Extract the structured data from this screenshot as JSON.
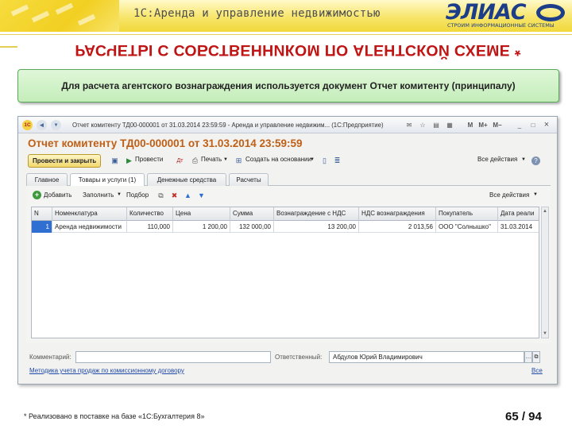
{
  "slide": {
    "app_heading": "1С:Аренда и управление недвижимостью",
    "logo_text": "ЭЛИАС",
    "logo_tagline": "СТРОИМ ИНФОРМАЦИОННЫЕ СИСТЕМЫ",
    "title": "РАСЧЕТЫ С СОБСТВЕННИКОМ ПО АГЕНТСКОЙ СХЕМЕ *",
    "info_text": "Для расчета агентского вознаграждения используется документ Отчет комитенту (принципалу)",
    "footnote": "* Реализовано в поставке на базе «1С:Бухгалтерия 8»",
    "page_number": "65 / 94",
    "colors": {
      "title": "#c01515",
      "accent_yellow": "#f1d83a",
      "info_box": "#c4edba",
      "brand_blue": "#1c3e8a"
    }
  },
  "window": {
    "title": "Отчет комитенту ТД00-000001 от 31.03.2014 23:59:59 - Аренда и управление недвижим... (1С:Предприятие)",
    "title_icons": [
      "1c-logo-icon",
      "back-icon",
      "dropdown-icon"
    ],
    "controls": {
      "m": "M",
      "m_plus": "M+",
      "m_minus": "M−",
      "minimize": "_",
      "restore": "□",
      "close": "×"
    }
  },
  "document": {
    "heading": "Отчет комитенту ТД00-000001 от 31.03.2014 23:59:59",
    "commands": {
      "post_close": "Провести и закрыть",
      "post": "Провести",
      "print": "Печать",
      "create_based_on": "Создать на основании",
      "all_actions": "Все действия"
    },
    "tabs": [
      "Главное",
      "Товары и услуги (1)",
      "Денежные средства",
      "Расчеты"
    ],
    "table_toolbar": {
      "add": "Добавить",
      "fill": "Заполнить",
      "pick": "Подбор",
      "all_actions": "Все действия"
    },
    "table": {
      "columns": [
        "N",
        "Номенклатура",
        "Количество",
        "Цена",
        "Сумма",
        "Вознаграждение с НДС",
        "НДС вознаграждения",
        "Покупатель",
        "Дата реали"
      ],
      "rows": [
        [
          "1",
          "Аренда недвижимости",
          "110,000",
          "1 200,00",
          "132 000,00",
          "13 200,00",
          "2 013,56",
          "ООО \"Солнышко\"",
          "31.03.2014"
        ]
      ]
    },
    "comment_label": "Комментарий:",
    "comment_value": "",
    "responsible_label": "Ответственный:",
    "responsible_value": "Абдулов Юрий Владимирович",
    "method_link": "Методика учета продаж по комиссионному договору",
    "all_link": "Все"
  }
}
